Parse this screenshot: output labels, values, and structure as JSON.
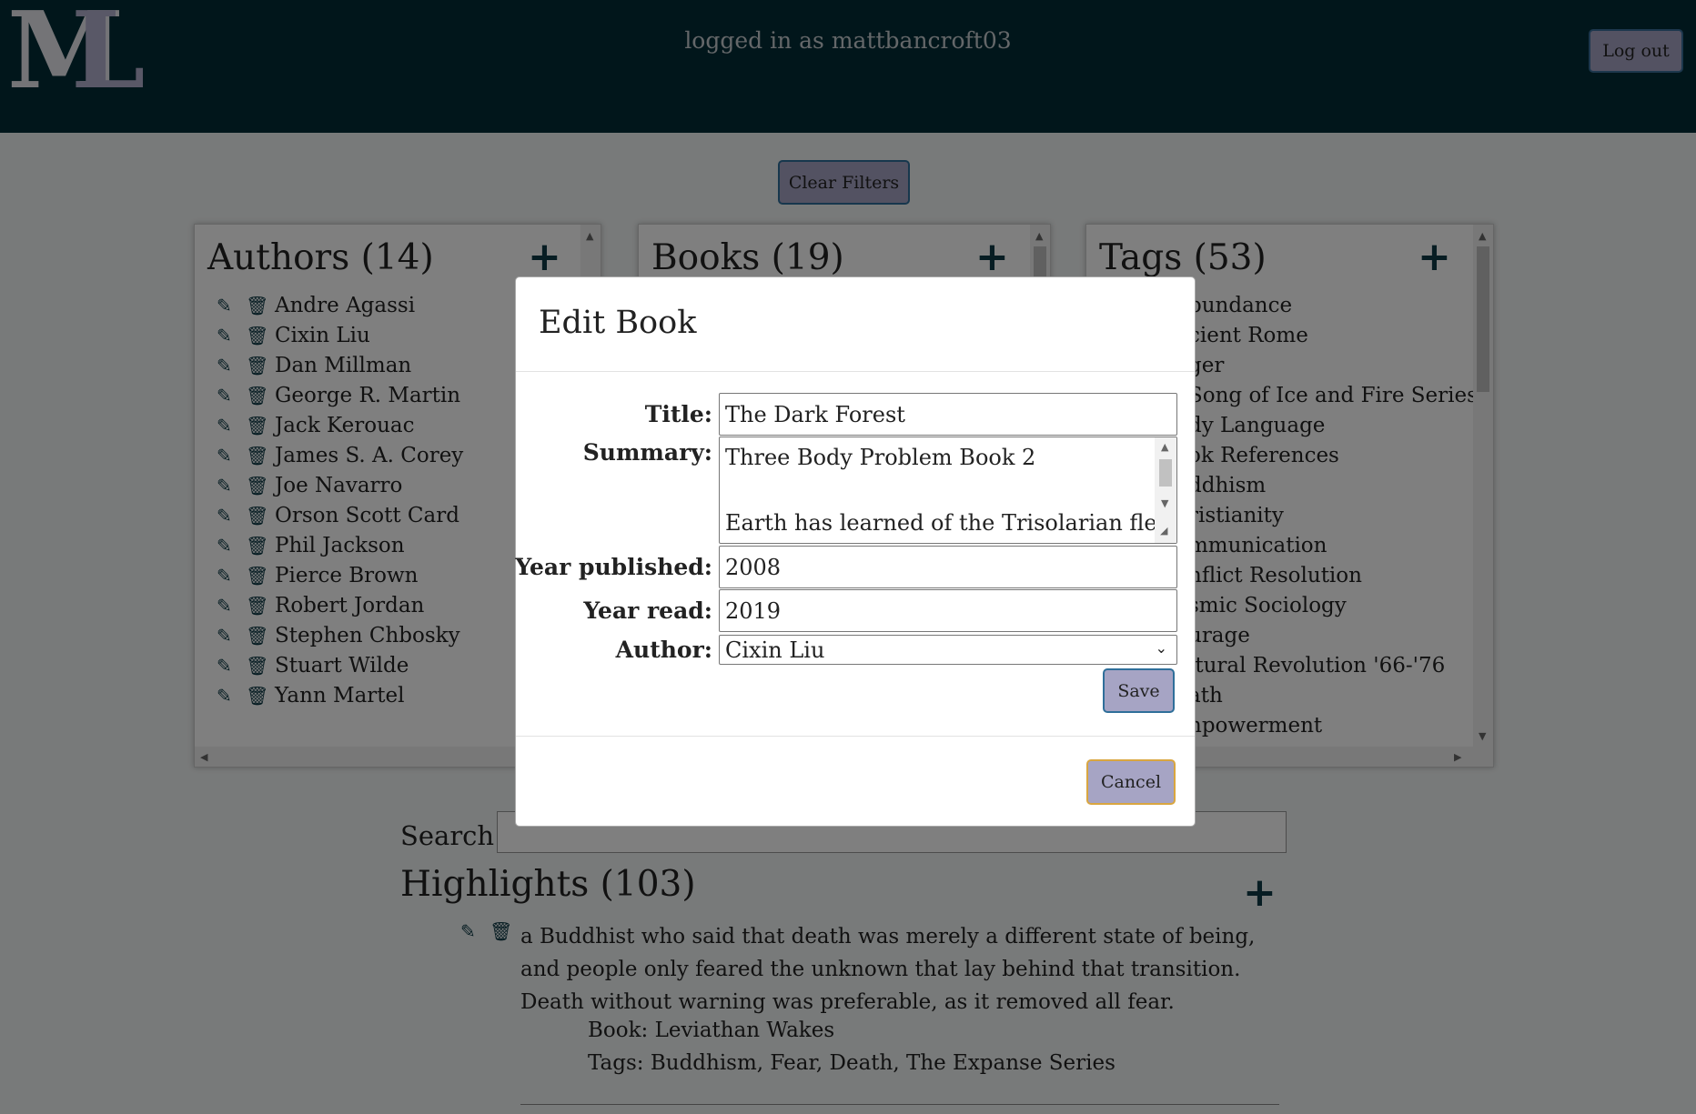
{
  "header": {
    "logo_m": "M",
    "logo_l": "L",
    "logged_in_text": "logged in as mattbancroft03",
    "logout_label": "Log out"
  },
  "filters": {
    "clear_label": "Clear Filters"
  },
  "authors": {
    "title": "Authors (14)",
    "items": [
      "Andre Agassi",
      "Cixin Liu",
      "Dan Millman",
      "George R. Martin",
      "Jack Kerouac",
      "James S. A. Corey",
      "Joe Navarro",
      "Orson Scott Card",
      "Phil Jackson",
      "Pierce Brown",
      "Robert Jordan",
      "Stephen Chbosky",
      "Stuart Wilde",
      "Yann Martel"
    ]
  },
  "books": {
    "title": "Books (19)"
  },
  "tags": {
    "title": "Tags (53)",
    "items": [
      "bundance",
      "cient Rome",
      "ger",
      "Song of Ice and Fire Series",
      "dy Language",
      "ok References",
      "ddhism",
      "ristianity",
      "mmunication",
      "nflict Resolution",
      "smic Sociology",
      "urage",
      "ltural Revolution '66-'76",
      "ath",
      "npowerment"
    ]
  },
  "search": {
    "label": "Search:",
    "value": ""
  },
  "highlights": {
    "title": "Highlights (103)",
    "first": {
      "text": "a Buddhist who said that death was merely a different state of being, and people only feared the unknown that lay behind that transition. Death without warning was preferable, as it removed all fear.",
      "book": "Book: Leviathan Wakes",
      "tags": "Tags: Buddhism, Fear, Death, The Expanse Series"
    }
  },
  "modal": {
    "title": "Edit Book",
    "title_label": "Title:",
    "title_value": "The Dark Forest",
    "summary_label": "Summary:",
    "summary_line1": "Three Body Problem Book 2",
    "summary_line2": "Earth has learned of the Trisolarian fleet",
    "year_published_label": "Year published:",
    "year_published_value": "2008",
    "year_read_label": "Year read:",
    "year_read_value": "2019",
    "author_label": "Author:",
    "author_value": "Cixin Liu",
    "save_label": "Save",
    "cancel_label": "Cancel"
  },
  "colors": {
    "header_bg": "#022c36",
    "button_bg": "#a6a4c4",
    "icon_color": "#0e3b46",
    "cancel_border": "#d9a640"
  }
}
